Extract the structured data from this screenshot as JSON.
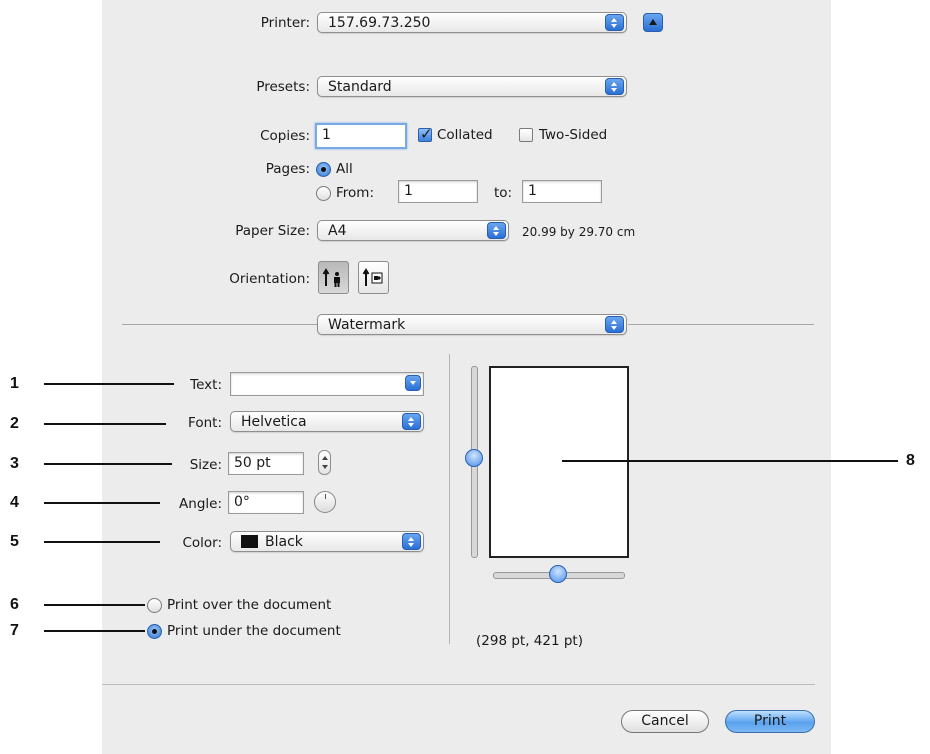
{
  "printer": {
    "label": "Printer:",
    "value": "157.69.73.250"
  },
  "presets": {
    "label": "Presets:",
    "value": "Standard"
  },
  "copies": {
    "label": "Copies:",
    "value": "1",
    "collated_label": "Collated",
    "collated_checked": true,
    "two_sided_label": "Two-Sided",
    "two_sided_checked": false
  },
  "pages": {
    "label": "Pages:",
    "all_label": "All",
    "from_label": "From:",
    "from_value": "1",
    "to_label": "to:",
    "to_value": "1",
    "selected": "All"
  },
  "paper_size": {
    "label": "Paper Size:",
    "value": "A4",
    "dimensions": "20.99 by 29.70 cm"
  },
  "orientation": {
    "label": "Orientation:",
    "selected": "portrait"
  },
  "section": {
    "value": "Watermark"
  },
  "watermark": {
    "text_label": "Text:",
    "text_value": "",
    "font_label": "Font:",
    "font_value": "Helvetica",
    "size_label": "Size:",
    "size_value": "50 pt",
    "angle_label": "Angle:",
    "angle_value": "0°",
    "color_label": "Color:",
    "color_value": "Black",
    "color_swatch": "#111111",
    "over_label": "Print over the document",
    "under_label": "Print under the document",
    "placement_selected": "under",
    "position_readout": "(298 pt, 421 pt)"
  },
  "buttons": {
    "cancel": "Cancel",
    "print": "Print"
  },
  "callouts": [
    "1",
    "2",
    "3",
    "4",
    "5",
    "6",
    "7",
    "8"
  ],
  "colors": {
    "dialog_bg": "#ececec",
    "accent_blue": "#3d80de"
  },
  "icons": {
    "portrait": "portrait-orientation-icon",
    "landscape": "landscape-orientation-icon",
    "disclosure": "disclosure-triangle-icon"
  }
}
